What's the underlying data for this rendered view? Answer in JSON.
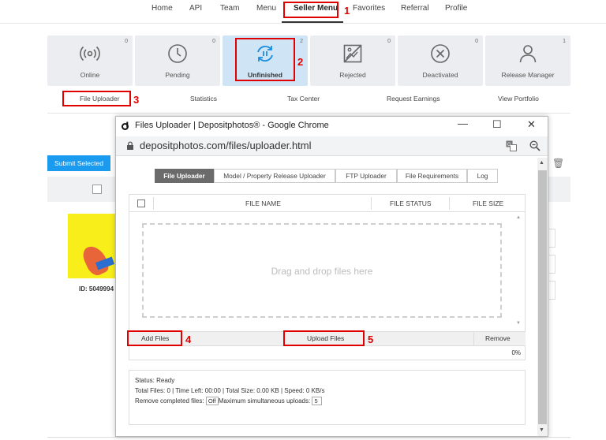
{
  "top_nav": {
    "items": [
      "Home",
      "API",
      "Team",
      "Menu",
      "Seller Menu",
      "Favorites",
      "Referral",
      "Profile"
    ]
  },
  "tiles": [
    {
      "label": "Online",
      "count": "0",
      "icon": "broadcast-icon"
    },
    {
      "label": "Pending",
      "count": "0",
      "icon": "clock-icon"
    },
    {
      "label": "Unfinished",
      "count": "2",
      "icon": "refresh-pause-icon"
    },
    {
      "label": "Rejected",
      "count": "0",
      "icon": "crossed-image-icon"
    },
    {
      "label": "Deactivated",
      "count": "0",
      "icon": "circle-x-icon"
    },
    {
      "label": "Release Manager",
      "count": "1",
      "icon": "person-icon"
    }
  ],
  "sub_nav": {
    "items": [
      "File Uploader",
      "Statistics",
      "Tax Center",
      "Request Earnings",
      "View Portfolio"
    ]
  },
  "background_page": {
    "submit_selected": "Submit Selected",
    "item_id": "ID: 5049994"
  },
  "annotations": [
    "1",
    "2",
    "3",
    "4",
    "5"
  ],
  "browser": {
    "title": "Files Uploader | Depositphotos® - Google Chrome",
    "url": "depositphotos.com/files/uploader.html"
  },
  "uploader": {
    "tabs": [
      "File Uploader",
      "Model / Property Release Uploader",
      "FTP Uploader",
      "File Requirements",
      "Log"
    ],
    "columns": [
      "FILE NAME",
      "FILE STATUS",
      "FILE SIZE"
    ],
    "drop_text": "Drag and drop files here",
    "add_files": "Add Files",
    "upload_files": "Upload Files",
    "remove": "Remove",
    "progress": "0%",
    "status_line": "Status: Ready",
    "totals_line": "Total Files: 0 | Time Left: 00:00 | Total Size: 0.00 KB | Speed: 0 KB/s",
    "remove_completed_label": "Remove completed files:",
    "remove_completed_value": "Off",
    "max_uploads_label": "Maximum simultaneous uploads:",
    "max_uploads_value": "5"
  }
}
